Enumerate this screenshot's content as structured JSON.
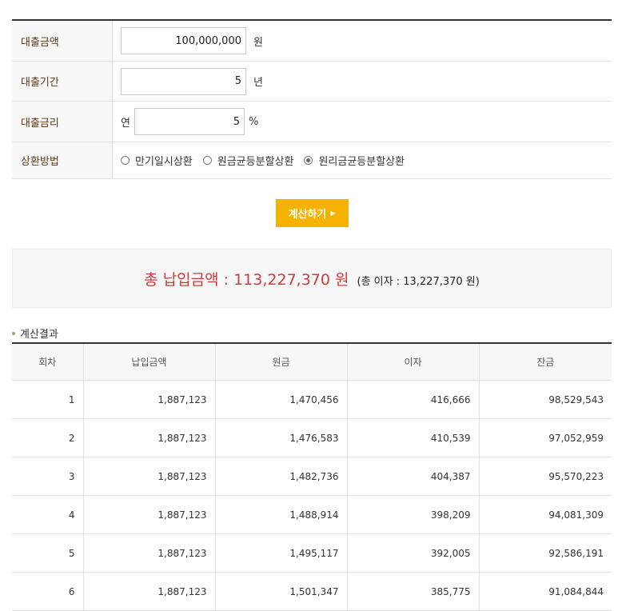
{
  "form": {
    "amount": {
      "label": "대출금액",
      "value": "100,000,000",
      "unit": "원"
    },
    "period": {
      "label": "대출기간",
      "value": "5",
      "unit": "년"
    },
    "rate": {
      "label": "대출금리",
      "prefix": "연",
      "value": "5",
      "unit": "%"
    },
    "method": {
      "label": "상환방법",
      "options": [
        {
          "label": "만기일시상환",
          "selected": false
        },
        {
          "label": "원금균등분할상환",
          "selected": false
        },
        {
          "label": "원리금균등분할상환",
          "selected": true
        }
      ]
    }
  },
  "button": {
    "label": "계산하기"
  },
  "summary": {
    "total": "총 납입금액 : 113,227,370 원",
    "interest": "(총 이자 :  13,227,370 원)"
  },
  "result": {
    "title": "계산결과",
    "headers": [
      "회차",
      "납입금액",
      "원금",
      "이자",
      "잔금"
    ],
    "rows": [
      [
        "1",
        "1,887,123",
        "1,470,456",
        "416,666",
        "98,529,543"
      ],
      [
        "2",
        "1,887,123",
        "1,476,583",
        "410,539",
        "97,052,959"
      ],
      [
        "3",
        "1,887,123",
        "1,482,736",
        "404,387",
        "95,570,223"
      ],
      [
        "4",
        "1,887,123",
        "1,488,914",
        "398,209",
        "94,081,309"
      ],
      [
        "5",
        "1,887,123",
        "1,495,117",
        "392,005",
        "92,586,191"
      ],
      [
        "6",
        "1,887,123",
        "1,501,347",
        "385,775",
        "91,084,844"
      ]
    ]
  },
  "colors": {
    "accent": "#f5b200",
    "total_text": "#d03a3a",
    "label_text": "#5a3b13",
    "header_bg": "#f7f7f7"
  }
}
